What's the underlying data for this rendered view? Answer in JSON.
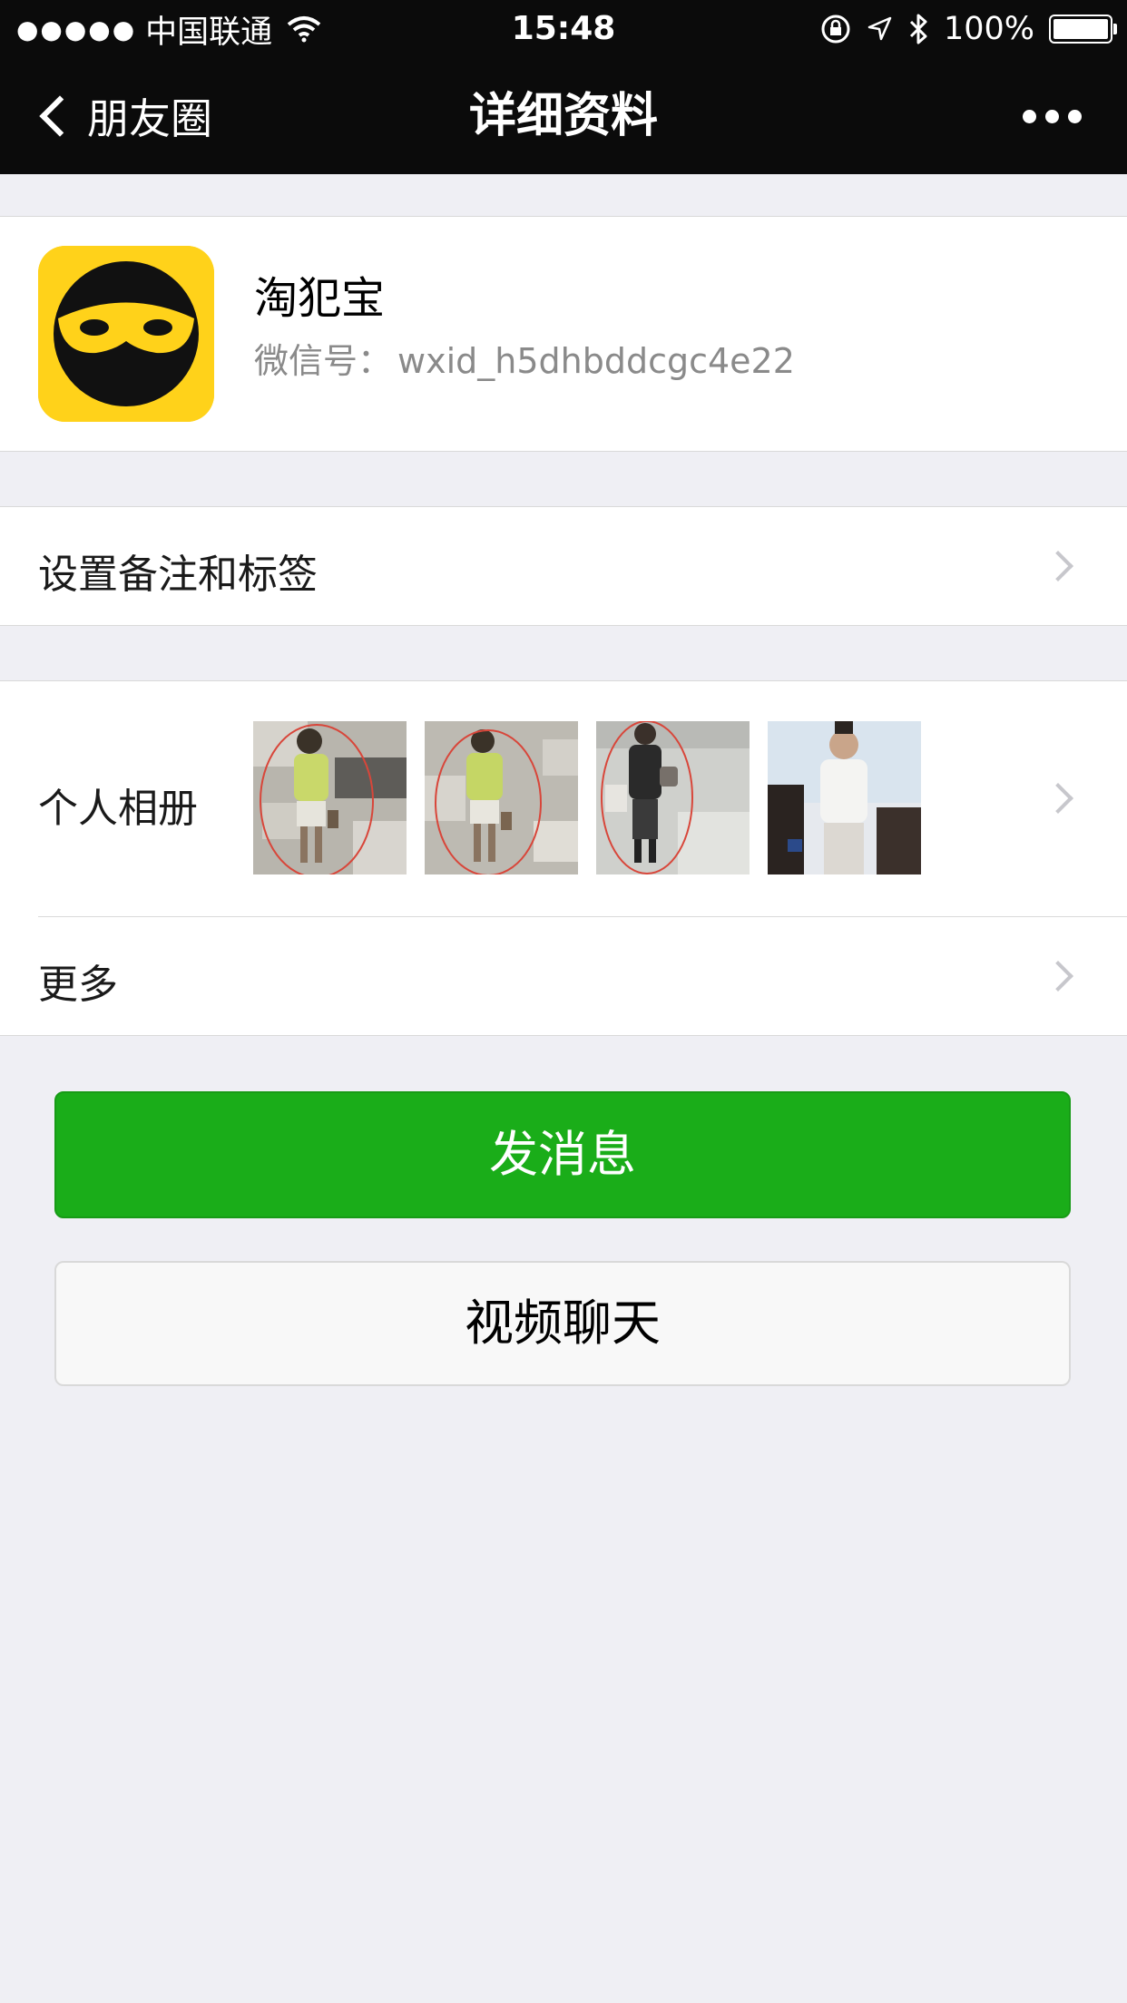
{
  "status_bar": {
    "signal_dots": "●●●●●",
    "carrier": "中国联通",
    "time": "15:48",
    "battery_text": "100%",
    "icons": [
      "wifi-icon",
      "orientation-lock-icon",
      "location-icon",
      "bluetooth-icon",
      "battery-icon"
    ]
  },
  "nav": {
    "back_label": "朋友圈",
    "title": "详细资料",
    "more_icon": "more-dots-icon"
  },
  "profile": {
    "name": "淘犯宝",
    "wechat_id_label": "微信号：",
    "wechat_id": "wxid_h5dhbddcgc4e22",
    "avatar_colors": {
      "background": "#ffd21a",
      "face": "#111111"
    }
  },
  "rows": {
    "remark_label": "设置备注和标签",
    "album_label": "个人相册",
    "more_label": "更多"
  },
  "buttons": {
    "send_message": "发消息",
    "video_chat": "视频聊天"
  },
  "colors": {
    "nav_bg": "#0b0b0b",
    "page_bg": "#efeff4",
    "primary_green": "#1aad19",
    "secondary_gray": "#8a8a8a"
  }
}
